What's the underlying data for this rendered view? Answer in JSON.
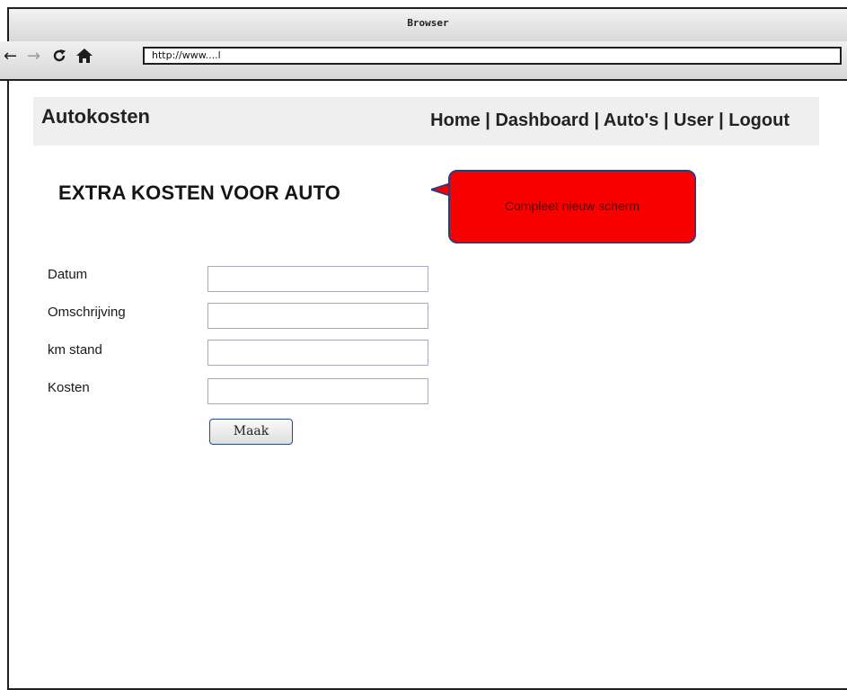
{
  "browser": {
    "title": "Browser",
    "url": "http://www....l",
    "icons": [
      "back-arrow-icon",
      "forward-arrow-icon",
      "reload-icon",
      "home-icon"
    ]
  },
  "header": {
    "brand": "Autokosten",
    "nav": {
      "home": "Home",
      "dashboard": "Dashboard",
      "autos": "Auto's",
      "user": "User",
      "logout": "Logout",
      "separator": " | "
    }
  },
  "main": {
    "heading": "EXTRA KOSTEN VOOR AUTO",
    "callout": "Compleet nieuw scherm",
    "fields": [
      {
        "label": "Datum",
        "value": ""
      },
      {
        "label": "Omschrijving",
        "value": ""
      },
      {
        "label": "km stand",
        "value": ""
      },
      {
        "label": "Kosten",
        "value": ""
      }
    ],
    "submit_label": "Maak"
  },
  "colors": {
    "callout_fill": "#f90000",
    "callout_border": "#2f3c7a",
    "header_bg": "#efefef"
  }
}
